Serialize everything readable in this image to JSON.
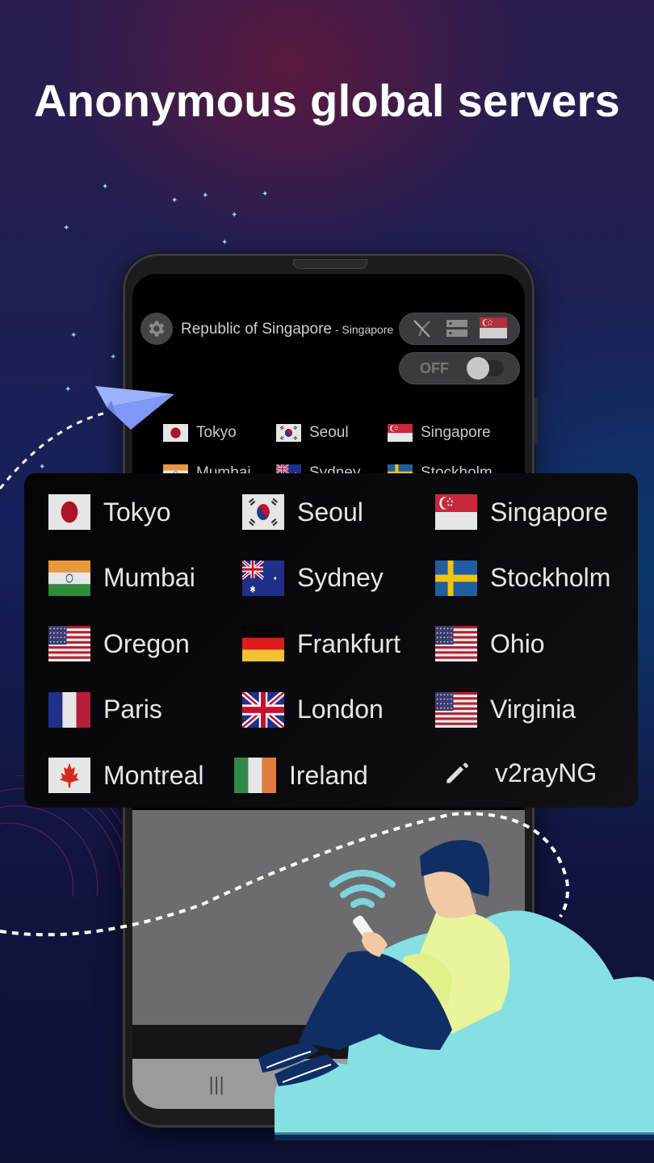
{
  "headline": "Anonymous global servers",
  "colors": {
    "cloud": "#86e0e3",
    "person_hair": "#0f2e63",
    "person_shirt": "#e8f59c",
    "wifi": "#7ed3dc",
    "plane": "#8aa2ff"
  },
  "app": {
    "settings_icon": "gear-icon",
    "location_title": "Republic of Singapore",
    "location_separator": " - ",
    "location_subtitle": "Singapore",
    "toolbar_icons": [
      "no-routing-icon",
      "server-list-icon",
      "singapore-flag-icon"
    ],
    "toggle_label": "OFF",
    "toggle_state": "off",
    "nav_recent_glyph": "|||",
    "small_list": [
      {
        "label": "Tokyo",
        "flag": "jp"
      },
      {
        "label": "Seoul",
        "flag": "kr"
      },
      {
        "label": "Singapore",
        "flag": "sg"
      },
      {
        "label": "Mumbai",
        "flag": "in"
      },
      {
        "label": "Sydney",
        "flag": "au"
      },
      {
        "label": "Stockholm",
        "flag": "se"
      }
    ]
  },
  "servers": [
    {
      "label": "Tokyo",
      "flag": "jp"
    },
    {
      "label": "Seoul",
      "flag": "kr"
    },
    {
      "label": "Singapore",
      "flag": "sg"
    },
    {
      "label": "Mumbai",
      "flag": "in"
    },
    {
      "label": "Sydney",
      "flag": "au"
    },
    {
      "label": "Stockholm",
      "flag": "se"
    },
    {
      "label": "Oregon",
      "flag": "us"
    },
    {
      "label": "Frankfurt",
      "flag": "de"
    },
    {
      "label": "Ohio",
      "flag": "us"
    },
    {
      "label": "Paris",
      "flag": "fr"
    },
    {
      "label": "London",
      "flag": "gb"
    },
    {
      "label": "Virginia",
      "flag": "us"
    },
    {
      "label": "Montreal",
      "flag": "ca"
    },
    {
      "label": "Ireland",
      "flag": "ie"
    },
    {
      "label": "v2rayNG",
      "flag": "edit"
    }
  ]
}
